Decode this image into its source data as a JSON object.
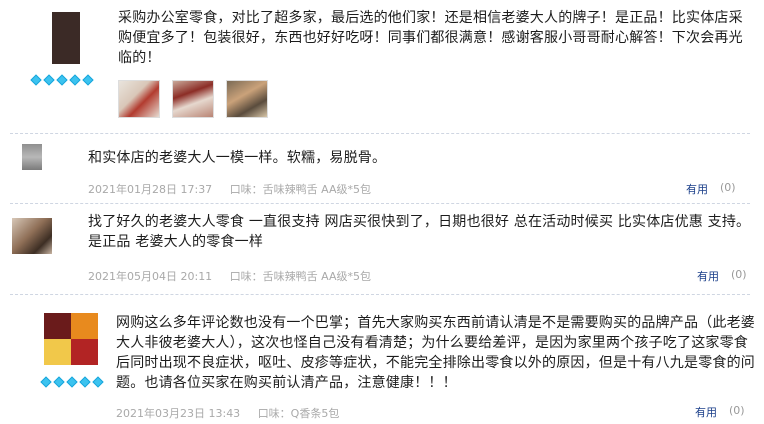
{
  "reviews": [
    {
      "text": "采购办公室零食，对比了超多家，最后选的他们家！还是相信老婆大人的牌子！是正品！比实体店采购便宜多了！包装很好，东西也好好吃呀！同事们都很满意！感谢客服小哥哥耐心解答！下次会再光临的！",
      "date": "",
      "taste": "",
      "useful": "",
      "count": "",
      "avatar_color": "#3b2a26",
      "photos": [
        "photo-1",
        "photo-2",
        "photo-3"
      ]
    },
    {
      "text": "和实体店的老婆大人一模一样。软糯，易脱骨。",
      "date": "2021年01月28日 17:37",
      "taste": "口味：舌味辣鸭舌 AA级*5包",
      "useful": "有用",
      "count": "(0)",
      "avatar_color": "#9a9a9a"
    },
    {
      "text": "找了好久的老婆大人零食 一直很支持 网店买很快到了，日期也很好 总在活动时候买 比实体店优惠 支持。是正品 老婆大人的零食一样",
      "date": "2021年05月04日 20:11",
      "taste": "口味：舌味辣鸭舌 AA级*5包",
      "useful": "有用",
      "count": "(0)",
      "avatar_color": "#b59a85"
    },
    {
      "text": "网购这么多年评论数也没有一个巴掌；首先大家购买东西前请认清是不是需要购买的品牌产品（此老婆大人非彼老婆大人），这次也怪自己没有看清楚；为什么要给差评，是因为家里两个孩子吃了这家零食后同时出现不良症状，呕吐、皮疹等症状，不能完全排除出零食以外的原因，但是十有八九是零食的问题。也请各位买家在购买前认清产品，注意健康！！！",
      "date": "2021年03月23日 13:43",
      "taste": "口味：Q香条5包",
      "useful": "有用",
      "count": "(0)",
      "avatar_color": "#e88a1e"
    }
  ]
}
